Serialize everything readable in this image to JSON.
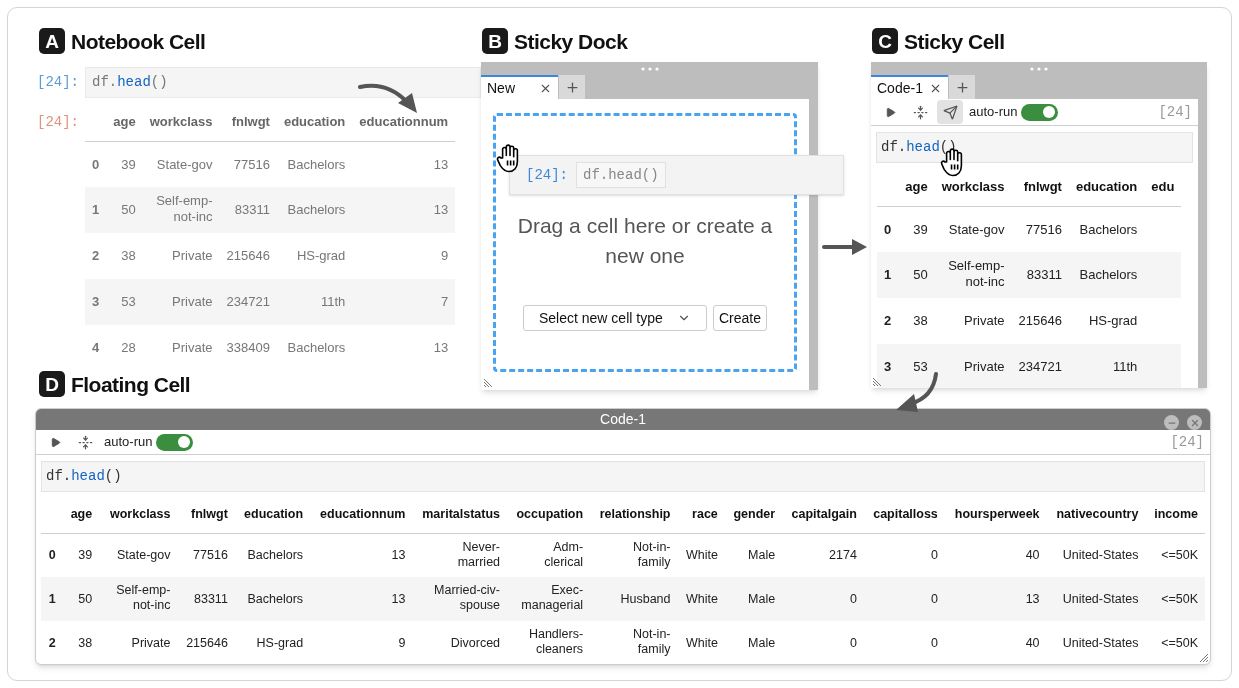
{
  "notebook_cell": {
    "badge": "A",
    "title": "Notebook Cell",
    "input_prompt": "[24]:",
    "code": [
      {
        "text": "df.",
        "kind": "plain"
      },
      {
        "text": "head",
        "kind": "method"
      },
      {
        "text": "()",
        "kind": "plain"
      }
    ],
    "output_prompt": "[24]:",
    "table": {
      "columns": [
        "",
        "age",
        "workclass",
        "fnlwgt",
        "education",
        "educationnum"
      ],
      "rows": [
        [
          "0",
          "39",
          "State-gov",
          "77516",
          "Bachelors",
          "13"
        ],
        [
          "1",
          "50",
          "Self-emp-not-inc",
          "83311",
          "Bachelors",
          "13"
        ],
        [
          "2",
          "38",
          "Private",
          "215646",
          "HS-grad",
          "9"
        ],
        [
          "3",
          "53",
          "Private",
          "234721",
          "11th",
          "7"
        ],
        [
          "4",
          "28",
          "Private",
          "338409",
          "Bachelors",
          "13"
        ]
      ]
    }
  },
  "floating_heading": {
    "badge": "D",
    "title": "Floating Cell"
  },
  "sticky_dock": {
    "badge": "B",
    "title": "Sticky Dock",
    "tabs": [
      {
        "label": "New",
        "selected": true
      }
    ],
    "dragged_cell": {
      "prompt": "[24]:",
      "code": [
        {
          "text": "df.head()",
          "kind": "plain"
        }
      ]
    },
    "message": "Drag a cell here or create a new one",
    "select": {
      "value": "Select new cell type"
    },
    "create_button": "Create"
  },
  "sticky_cell": {
    "badge": "C",
    "title": "Sticky Cell",
    "tabs": [
      {
        "label": "Code-1",
        "selected": true
      }
    ],
    "toolbar": {
      "buttons": [
        {
          "kind": "run",
          "hovered": false
        },
        {
          "kind": "collapse",
          "hovered": false
        },
        {
          "kind": "send",
          "hovered": true
        }
      ],
      "auto_run_label": "auto-run",
      "auto_run_on": true,
      "execution_count": "[24]"
    },
    "code": [
      {
        "text": "df.",
        "kind": "plain"
      },
      {
        "text": "head",
        "kind": "method"
      },
      {
        "text": "()",
        "kind": "plain"
      }
    ],
    "table": {
      "columns": [
        "",
        "age",
        "workclass",
        "fnlwgt",
        "education",
        "edu"
      ],
      "rows": [
        [
          "0",
          "39",
          "State-gov",
          "77516",
          "Bachelors"
        ],
        [
          "1",
          "50",
          "Self-emp-not-inc",
          "83311",
          "Bachelors"
        ],
        [
          "2",
          "38",
          "Private",
          "215646",
          "HS-grad"
        ],
        [
          "3",
          "53",
          "Private",
          "234721",
          "11th"
        ]
      ]
    }
  },
  "floating_cell": {
    "window_title": "Code-1",
    "toolbar": {
      "buttons": [
        {
          "kind": "run",
          "hovered": false
        },
        {
          "kind": "collapse",
          "hovered": false
        }
      ],
      "auto_run_label": "auto-run",
      "auto_run_on": true,
      "execution_count": "[24]"
    },
    "code": [
      {
        "text": "df.",
        "kind": "plain"
      },
      {
        "text": "head",
        "kind": "method"
      },
      {
        "text": "()",
        "kind": "plain"
      }
    ],
    "table": {
      "columns": [
        "",
        "age",
        "workclass",
        "fnlwgt",
        "education",
        "educationnum",
        "maritalstatus",
        "occupation",
        "relationship",
        "race",
        "gender",
        "capitalgain",
        "capitalloss",
        "hoursperweek",
        "nativecountry",
        "income"
      ],
      "rows": [
        [
          "0",
          "39",
          "State-gov",
          "77516",
          "Bachelors",
          "13",
          "Never-married",
          "Adm-clerical",
          "Not-in-family",
          "White",
          "Male",
          "2174",
          "0",
          "40",
          "United-States",
          "<=50K"
        ],
        [
          "1",
          "50",
          "Self-emp-not-inc",
          "83311",
          "Bachelors",
          "13",
          "Married-civ-spouse",
          "Exec-managerial",
          "Husband",
          "White",
          "Male",
          "0",
          "0",
          "13",
          "United-States",
          "<=50K"
        ],
        [
          "2",
          "38",
          "Private",
          "215646",
          "HS-grad",
          "9",
          "Divorced",
          "Handlers-cleaners",
          "Not-in-family",
          "White",
          "Male",
          "0",
          "0",
          "40",
          "United-States",
          "<=50K"
        ]
      ]
    }
  }
}
